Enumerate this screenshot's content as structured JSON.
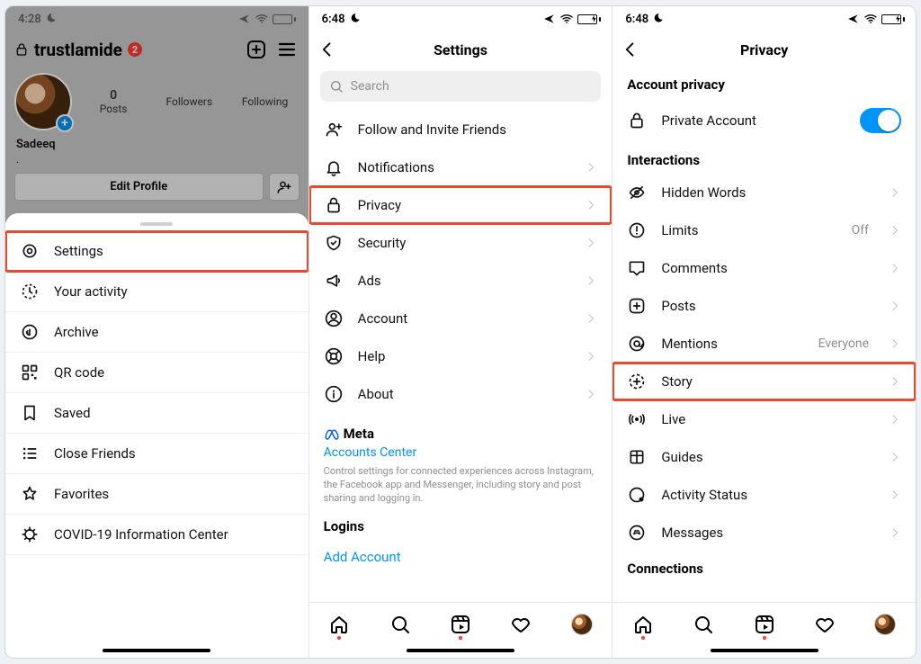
{
  "pane1": {
    "status": {
      "time": "4:28",
      "moon": true,
      "airplane": true,
      "wifi": true,
      "battery_pct": 15,
      "battery_color": "#ffcc00"
    },
    "username": "trustlamide",
    "notif_count": "2",
    "display_name": "Sadeeq",
    "stats": {
      "posts_num": "0",
      "posts_lbl": "Posts",
      "followers_lbl": "Followers",
      "following_lbl": "Following"
    },
    "edit_profile": "Edit Profile",
    "menu": [
      {
        "icon": "settings",
        "label": "Settings",
        "highlight": true
      },
      {
        "icon": "activity",
        "label": "Your activity"
      },
      {
        "icon": "archive",
        "label": "Archive"
      },
      {
        "icon": "qr",
        "label": "QR code"
      },
      {
        "icon": "saved",
        "label": "Saved"
      },
      {
        "icon": "close-friends",
        "label": "Close Friends"
      },
      {
        "icon": "star",
        "label": "Favorites"
      },
      {
        "icon": "covid",
        "label": "COVID-19 Information Center"
      }
    ]
  },
  "pane2": {
    "status": {
      "time": "6:48",
      "moon": true,
      "airplane": true,
      "wifi": true,
      "battery_pct": 55,
      "battery_color": "#34c759",
      "charging": true
    },
    "title": "Settings",
    "search_placeholder": "Search",
    "rows": [
      {
        "icon": "invite",
        "label": "Follow and Invite Friends"
      },
      {
        "icon": "bell",
        "label": "Notifications",
        "chev": true
      },
      {
        "icon": "lock",
        "label": "Privacy",
        "chev": true,
        "highlight": true
      },
      {
        "icon": "shield",
        "label": "Security",
        "chev": true
      },
      {
        "icon": "ads",
        "label": "Ads",
        "chev": true
      },
      {
        "icon": "account",
        "label": "Account",
        "chev": true
      },
      {
        "icon": "help",
        "label": "Help",
        "chev": true
      },
      {
        "icon": "about",
        "label": "About",
        "chev": true
      }
    ],
    "meta_brand": "Meta",
    "accounts_center": "Accounts Center",
    "meta_desc": "Control settings for connected experiences across Instagram, the Facebook app and Messenger, including story and post sharing and logging in.",
    "logins_header": "Logins",
    "add_account": "Add Account"
  },
  "pane3": {
    "status": {
      "time": "6:48",
      "moon": true,
      "airplane": true,
      "wifi": true,
      "battery_pct": 55,
      "battery_color": "#34c759",
      "charging": true
    },
    "title": "Privacy",
    "section_account_privacy": "Account privacy",
    "private_account": "Private Account",
    "section_interactions": "Interactions",
    "rows": [
      {
        "icon": "hidden",
        "label": "Hidden Words",
        "chev": true
      },
      {
        "icon": "limits",
        "label": "Limits",
        "value": "Off",
        "chev": true
      },
      {
        "icon": "comments",
        "label": "Comments",
        "chev": true
      },
      {
        "icon": "posts",
        "label": "Posts",
        "chev": true
      },
      {
        "icon": "mentions",
        "label": "Mentions",
        "value": "Everyone",
        "chev": true
      },
      {
        "icon": "story",
        "label": "Story",
        "chev": true,
        "highlight": true
      },
      {
        "icon": "live",
        "label": "Live",
        "chev": true
      },
      {
        "icon": "guides",
        "label": "Guides",
        "chev": true
      },
      {
        "icon": "activity-status",
        "label": "Activity Status",
        "chev": true
      },
      {
        "icon": "messages",
        "label": "Messages",
        "chev": true
      }
    ],
    "section_connections": "Connections"
  }
}
